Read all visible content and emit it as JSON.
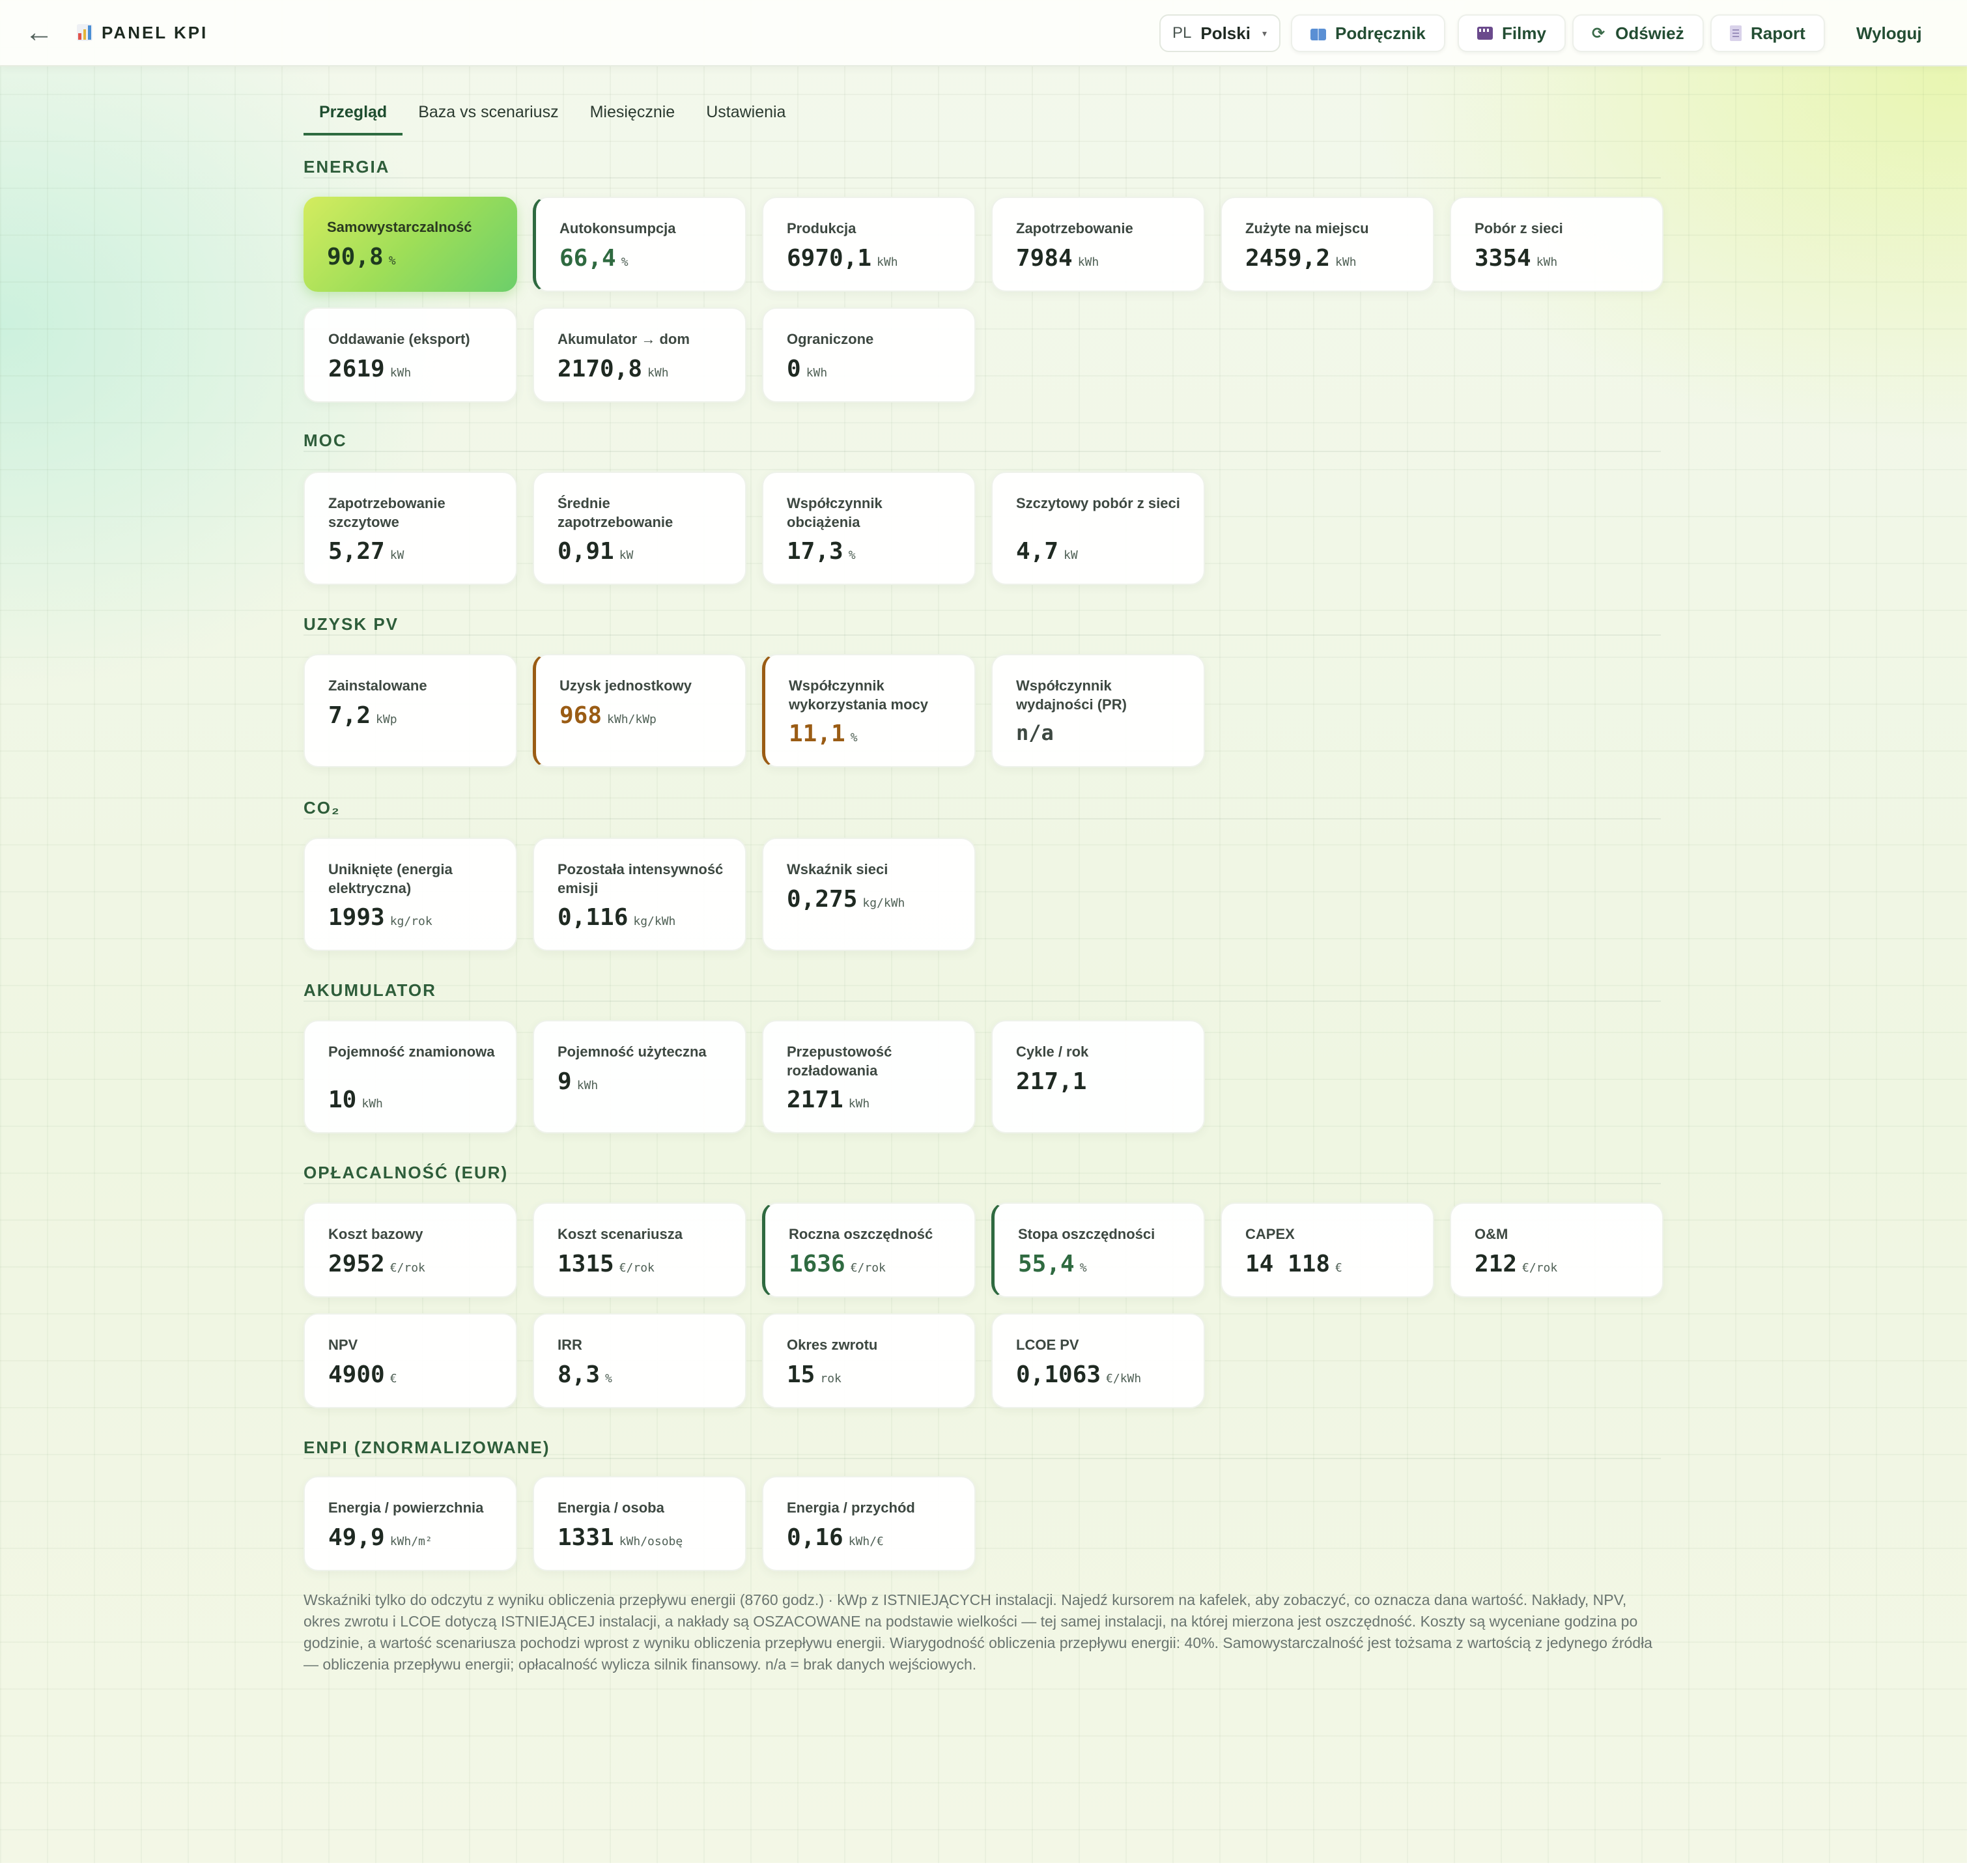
{
  "header": {
    "back_icon": "←",
    "title": "PANEL KPI",
    "lang_code": "PL",
    "lang_name": "Polski",
    "caret": "▾",
    "manual_label": "Podręcznik",
    "films_label": "Filmy",
    "refresh_glyph": "⟳",
    "refresh_label": "Odśwież",
    "report_label": "Raport",
    "logout_label": "Wyloguj"
  },
  "tabs": [
    "Przegląd",
    "Baza vs scenariusz",
    "Miesięcznie",
    "Ustawienia"
  ],
  "sections": {
    "energia": "ENERGIA",
    "moc": "MOC",
    "uzysk": "UZYSK PV",
    "co2": "CO₂",
    "akumulator": "AKUMULATOR",
    "oplacalnosc": "OPŁACALNOŚĆ (EUR)",
    "enpi": "ENPI (ZNORMALIZOWANE)"
  },
  "energia": [
    {
      "label": "Samowystarczalność",
      "value": "90,8",
      "unit": "%"
    },
    {
      "label": "Autokonsumpcja",
      "value": "66,4",
      "unit": "%"
    },
    {
      "label": "Produkcja",
      "value": "6970,1",
      "unit": "kWh"
    },
    {
      "label": "Zapotrzebowanie",
      "value": "7984",
      "unit": "kWh"
    },
    {
      "label": "Zużyte na miejscu",
      "value": "2459,2",
      "unit": "kWh"
    },
    {
      "label": "Pobór z sieci",
      "value": "3354",
      "unit": "kWh"
    },
    {
      "label": "Oddawanie (eksport)",
      "value": "2619",
      "unit": "kWh"
    },
    {
      "label": "Akumulator → dom",
      "value": "2170,8",
      "unit": "kWh"
    },
    {
      "label": "Ograniczone",
      "value": "0",
      "unit": "kWh"
    }
  ],
  "moc": [
    {
      "label": "Zapotrzebowanie szczytowe",
      "value": "5,27",
      "unit": "kW"
    },
    {
      "label": "Średnie zapotrzebowanie",
      "value": "0,91",
      "unit": "kW"
    },
    {
      "label": "Współczynnik obciążenia",
      "value": "17,3",
      "unit": "%"
    },
    {
      "label": "Szczytowy pobór z sieci",
      "value": "4,7",
      "unit": "kW"
    }
  ],
  "uzysk": [
    {
      "label": "Zainstalowane",
      "value": "7,2",
      "unit": "kWp"
    },
    {
      "label": "Uzysk jednostkowy",
      "value": "968",
      "unit": "kWh/kWp"
    },
    {
      "label": "Współczynnik wykorzystania mocy",
      "value": "11,1",
      "unit": "%"
    },
    {
      "label": "Współczynnik wydajności (PR)",
      "value": "n/a",
      "unit": ""
    }
  ],
  "co2": [
    {
      "label": "Uniknięte (energia elektryczna)",
      "value": "1993",
      "unit": "kg/rok"
    },
    {
      "label": "Pozostała intensywność emisji",
      "value": "0,116",
      "unit": "kg/kWh"
    },
    {
      "label": "Wskaźnik sieci",
      "value": "0,275",
      "unit": "kg/kWh"
    }
  ],
  "akumulator": [
    {
      "label": "Pojemność znamionowa",
      "value": "10",
      "unit": "kWh"
    },
    {
      "label": "Pojemność użyteczna",
      "value": "9",
      "unit": "kWh"
    },
    {
      "label": "Przepustowość rozładowania",
      "value": "2171",
      "unit": "kWh"
    },
    {
      "label": "Cykle / rok",
      "value": "217,1",
      "unit": ""
    }
  ],
  "oplacalnosc": [
    {
      "label": "Koszt bazowy",
      "value": "2952",
      "unit": "€/rok"
    },
    {
      "label": "Koszt scenariusza",
      "value": "1315",
      "unit": "€/rok"
    },
    {
      "label": "Roczna oszczędność",
      "value": "1636",
      "unit": "€/rok"
    },
    {
      "label": "Stopa oszczędności",
      "value": "55,4",
      "unit": "%"
    },
    {
      "label": "CAPEX",
      "value": "14 118",
      "unit": "€"
    },
    {
      "label": "O&M",
      "value": "212",
      "unit": "€/rok"
    },
    {
      "label": "NPV",
      "value": "4900",
      "unit": "€"
    },
    {
      "label": "IRR",
      "value": "8,3",
      "unit": "%"
    },
    {
      "label": "Okres zwrotu",
      "value": "15",
      "unit": "rok"
    },
    {
      "label": "LCOE PV",
      "value": "0,1063",
      "unit": "€/kWh"
    }
  ],
  "enpi": [
    {
      "label": "Energia / powierzchnia",
      "value": "49,9",
      "unit": "kWh/m²"
    },
    {
      "label": "Energia / osoba",
      "value": "1331",
      "unit": "kWh/osobę"
    },
    {
      "label": "Energia / przychód",
      "value": "0,16",
      "unit": "kWh/€"
    }
  ],
  "footnote": "Wskaźniki tylko do odczytu z wyniku obliczenia przepływu energii (8760 godz.) · kWp z ISTNIEJĄCYCH instalacji. Najedź kursorem na kafelek, aby zobaczyć, co oznacza dana wartość. Nakłady, NPV, okres zwrotu i LCOE dotyczą ISTNIEJĄCEJ instalacji, a nakłady są OSZACOWANE na podstawie wielkości — tej samej instalacji, na której mierzona jest oszczędność. Koszty są wyceniane godzina po godzinie, a wartość scenariusza pochodzi wprost z wyniku obliczenia przepływu energii. Wiarygodność obliczenia przepływu energii: 40%. Samowystarczalność jest tożsama z wartością z jedynego źródła — obliczenia przepływu energii; opłacalność wylicza silnik finansowy. n/a = brak danych wejściowych."
}
